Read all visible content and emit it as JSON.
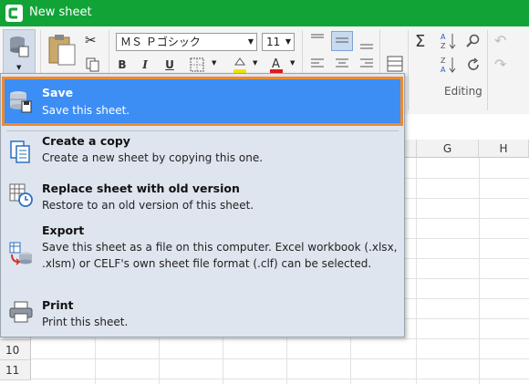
{
  "window": {
    "title": "New sheet"
  },
  "ribbon": {
    "font_name": "ＭＳ Ｐゴシック",
    "font_size": "11",
    "bold": "B",
    "italic": "I",
    "underline": "U",
    "editing_label": "Editing",
    "icons": [
      "file-menu-icon",
      "paste-icon",
      "cut-icon",
      "copy-icon",
      "border-icon",
      "fill-color-icon",
      "font-color-icon",
      "align-top-icon",
      "align-middle-icon",
      "align-bottom-icon",
      "align-left-icon",
      "align-center-icon",
      "align-right-icon",
      "wrap-icon",
      "sum-icon",
      "sort-asc-icon",
      "sort-desc-icon",
      "find-icon",
      "refresh-icon",
      "undo-icon",
      "redo-icon"
    ],
    "accent_color": "#12a337"
  },
  "sheet": {
    "columns": [
      "G",
      "H"
    ],
    "rows": [
      "10",
      "11"
    ]
  },
  "file_menu": {
    "items": [
      {
        "label": "Save",
        "desc": "Save this sheet.",
        "icon": "save-icon"
      },
      {
        "label": "Create a copy",
        "desc": "Create a new sheet by copying this one.",
        "icon": "copy-sheet-icon"
      },
      {
        "label": "Replace sheet with old version",
        "desc": "Restore to an old version of this sheet.",
        "icon": "history-icon"
      },
      {
        "label": "Export",
        "desc": "Save this sheet as a file on this computer. Excel workbook (.xlsx, .xlsm) or CELF's own sheet file format (.clf) can be selected.",
        "icon": "export-icon"
      },
      {
        "label": "Print",
        "desc": "Print this sheet.",
        "icon": "print-icon"
      }
    ],
    "highlight_color": "#3c8ef5",
    "focus_border_color": "#ec8a2d"
  }
}
